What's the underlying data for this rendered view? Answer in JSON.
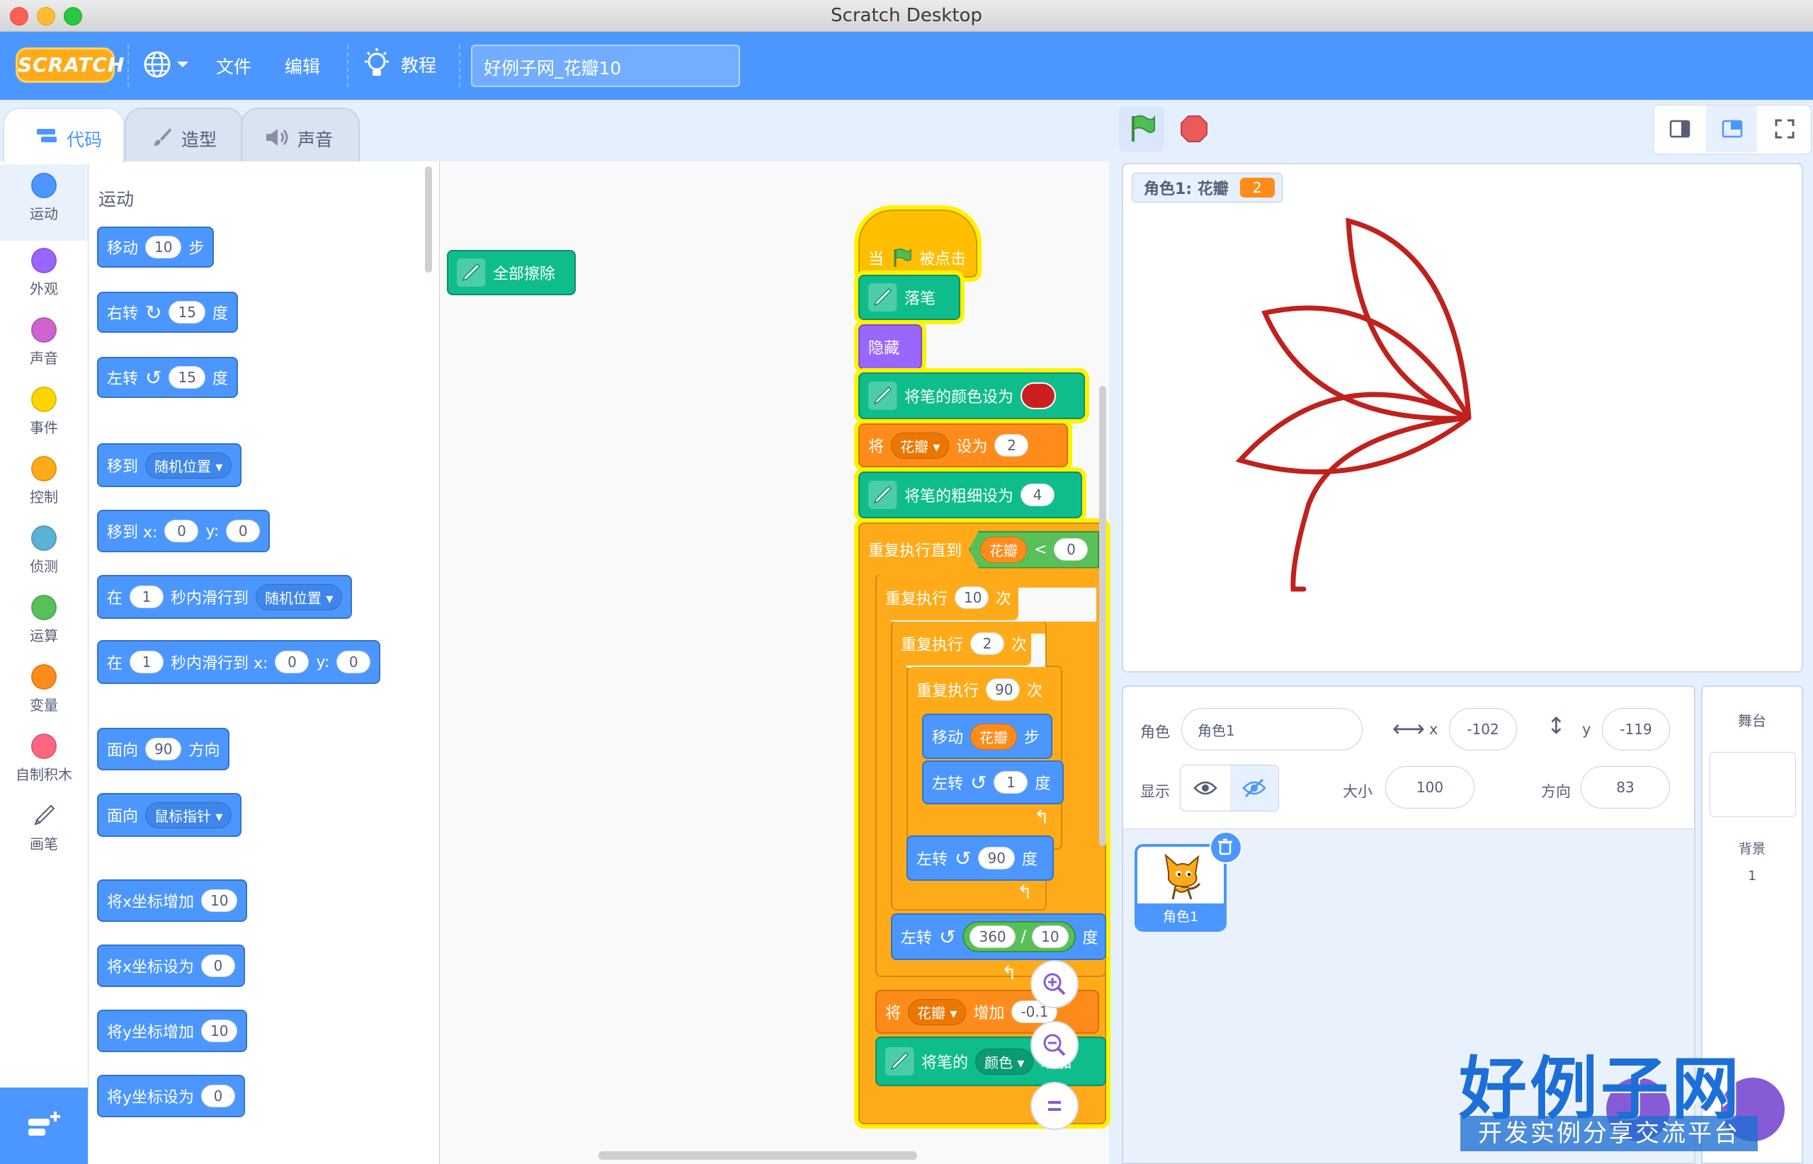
{
  "window": {
    "title": "Scratch Desktop"
  },
  "menubar": {
    "logo": "SCRATCH",
    "file": "文件",
    "edit": "编辑",
    "tutorials": "教程",
    "project_title": "好例子网_花瓣10"
  },
  "tabs": {
    "code": "代码",
    "costumes": "造型",
    "sounds": "声音"
  },
  "categories": [
    {
      "label": "运动",
      "color": "#4c97ff"
    },
    {
      "label": "外观",
      "color": "#9966ff"
    },
    {
      "label": "声音",
      "color": "#cf63cf"
    },
    {
      "label": "事件",
      "color": "#ffd500"
    },
    {
      "label": "控制",
      "color": "#ffab19"
    },
    {
      "label": "侦测",
      "color": "#5cb1d6"
    },
    {
      "label": "运算",
      "color": "#59c059"
    },
    {
      "label": "变量",
      "color": "#ff8c1a"
    },
    {
      "label": "自制积木",
      "color": "#ff6680"
    },
    {
      "label": "画笔",
      "color": "#0fbd8c"
    }
  ],
  "palette": {
    "heading": "运动",
    "move": {
      "a": "移动",
      "n": "10",
      "b": "步"
    },
    "turn_right": {
      "a": "右转",
      "n": "15",
      "b": "度"
    },
    "turn_left": {
      "a": "左转",
      "n": "15",
      "b": "度"
    },
    "goto": {
      "a": "移到",
      "d": "随机位置"
    },
    "goto_xy": {
      "a": "移到 x:",
      "x": "0",
      "b": "y:",
      "y": "0"
    },
    "glide": {
      "a": "在",
      "n": "1",
      "b": "秒内滑行到",
      "d": "随机位置"
    },
    "glide_xy": {
      "a": "在",
      "n": "1",
      "b": "秒内滑行到 x:",
      "x": "0",
      "c": "y:",
      "y": "0"
    },
    "point_dir": {
      "a": "面向",
      "n": "90",
      "b": "方向"
    },
    "point_towards": {
      "a": "面向",
      "d": "鼠标指针"
    },
    "change_x": {
      "a": "将x坐标增加",
      "n": "10"
    },
    "set_x": {
      "a": "将x坐标设为",
      "n": "0"
    },
    "change_y": {
      "a": "将y坐标增加",
      "n": "10"
    },
    "set_y": {
      "a": "将y坐标设为",
      "n": "0"
    }
  },
  "script": {
    "clear": "全部擦除",
    "hat": {
      "a": "当",
      "b": "被点击"
    },
    "pen_down": "落笔",
    "hide": "隐藏",
    "set_color": "将笔的颜色设为",
    "set_color_value": "#cc1f1f",
    "set_var": {
      "a": "将",
      "var": "花瓣",
      "b": "设为",
      "n": "2"
    },
    "set_size": {
      "a": "将笔的粗细设为",
      "n": "4"
    },
    "repeat_until": {
      "a": "重复执行直到",
      "var": "花瓣",
      "op": "<",
      "n": "0"
    },
    "repeat1": {
      "a": "重复执行",
      "n": "10",
      "b": "次"
    },
    "repeat2": {
      "a": "重复执行",
      "n": "2",
      "b": "次"
    },
    "repeat3": {
      "a": "重复执行",
      "n": "90",
      "b": "次"
    },
    "move": {
      "a": "移动",
      "var": "花瓣",
      "b": "步"
    },
    "turn1": {
      "a": "左转",
      "n": "1",
      "b": "度"
    },
    "turn90": {
      "a": "左转",
      "n": "90",
      "b": "度"
    },
    "turn_div": {
      "a": "左转",
      "n1": "360",
      "op": "/",
      "n2": "10",
      "b": "度"
    },
    "change_var": {
      "a": "将",
      "var": "花瓣",
      "b": "增加",
      "n": "-0.1"
    },
    "change_color": {
      "a": "将笔的",
      "d": "颜色",
      "b": "增加"
    }
  },
  "stage": {
    "monitor_label": "角色1: 花瓣",
    "monitor_value": "2",
    "pen_color": "#c0211d"
  },
  "sprite_info": {
    "sprite_label": "角色",
    "sprite_name": "角色1",
    "x_label": "x",
    "x": "-102",
    "y_label": "y",
    "y": "-119",
    "show_label": "显示",
    "size_label": "大小",
    "size": "100",
    "direction_label": "方向",
    "direction": "83"
  },
  "sprites": [
    {
      "name": "角色1"
    }
  ],
  "stage_pane": {
    "title": "舞台",
    "backdrops_label": "背景",
    "backdrops_count": "1"
  },
  "watermark": {
    "main": "好例子网",
    "sub": "开发实例分享交流平台"
  }
}
